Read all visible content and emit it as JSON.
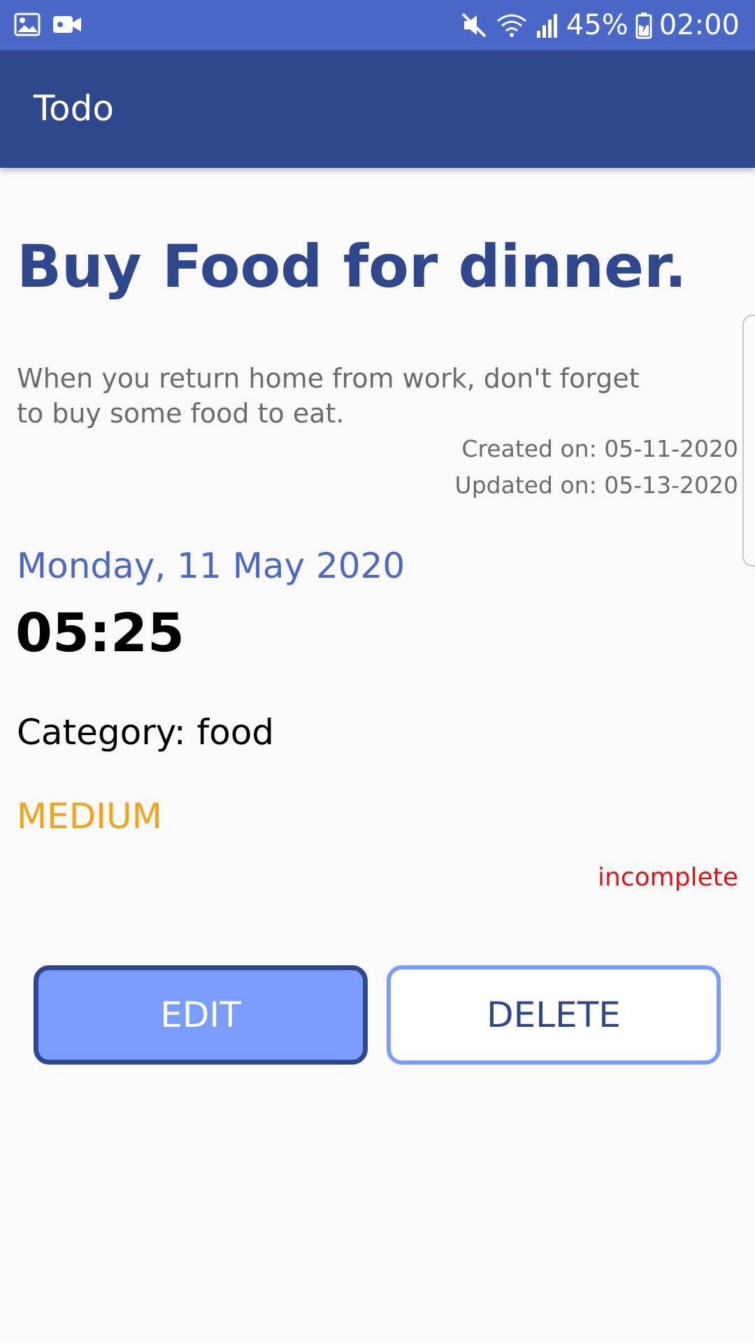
{
  "status_bar": {
    "battery": "45%",
    "time": "02:00",
    "icons": [
      "image-icon",
      "video-icon",
      "mute-icon",
      "wifi-icon",
      "signal-icon",
      "battery-icon"
    ]
  },
  "app_bar": {
    "title": "Todo"
  },
  "todo": {
    "title": "Buy Food for dinner.",
    "description": "When you return home from work, don't forget to buy some food to eat.",
    "created": "Created on: 05-11-2020",
    "updated": "Updated on: 05-13-2020",
    "date": "Monday, 11 May 2020",
    "time": "05:25",
    "category": "Category: food",
    "priority": "MEDIUM",
    "status": "incomplete"
  },
  "actions": {
    "edit_label": "EDIT",
    "delete_label": "DELETE"
  },
  "colors": {
    "status_bar": "#4a68c8",
    "app_bar": "#2f478c",
    "accent": "#7b9cff",
    "priority_medium": "#f5a316",
    "status_incomplete": "#e01414"
  }
}
